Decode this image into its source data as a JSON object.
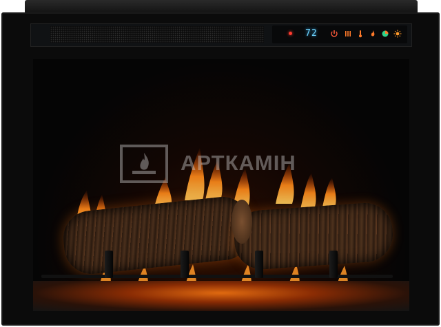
{
  "scene": {
    "description_role": "photo-of-electric-fireplace-insert",
    "colors": {
      "frame": "#0b0b0b",
      "display_text": "#6fd6ff",
      "indicator_red": "#ff3b2f",
      "flame_orange": "#ff8a1a",
      "flame_yellow": "#ffc040"
    }
  },
  "control_panel": {
    "temperature": "72",
    "buttons": [
      {
        "icon": "power-icon",
        "color": "#ff5a3a"
      },
      {
        "icon": "heat-bars-icon",
        "color": "#ff7a2a"
      },
      {
        "icon": "thermometer-icon",
        "color": "#ff7a2a"
      },
      {
        "icon": "flame-icon",
        "color": "#ff7a2a"
      },
      {
        "icon": "color-cycle-icon",
        "color": "#2fd18a"
      },
      {
        "icon": "brightness-icon",
        "color": "#ff9a2a"
      }
    ]
  },
  "watermark": {
    "text": "АРТКАМІН",
    "logo_icon": "fireplace-logo-icon"
  }
}
